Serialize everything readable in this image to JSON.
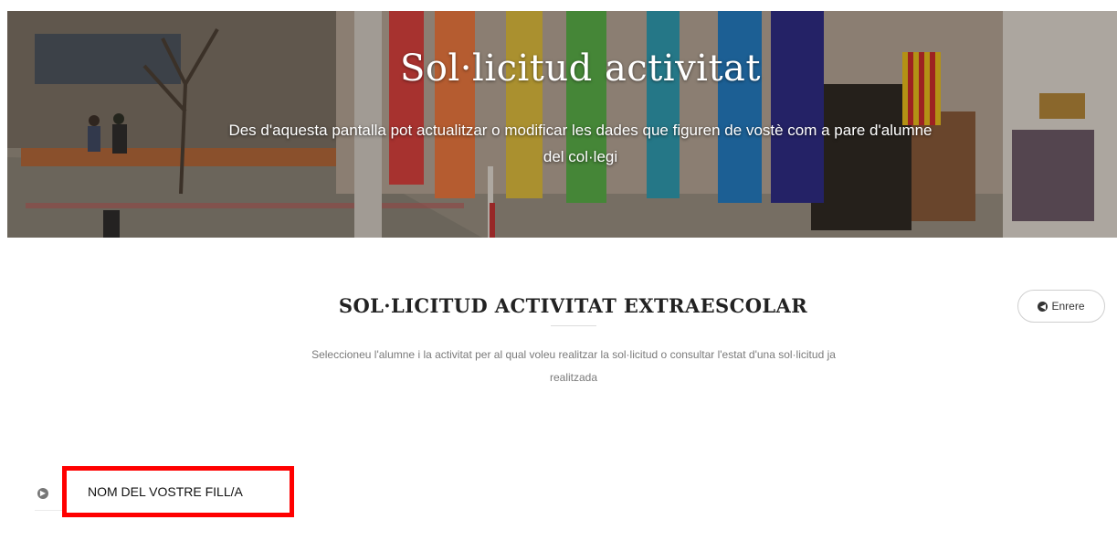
{
  "hero": {
    "title": "Sol·licitud activitat",
    "subtitle": "Des d'aquesta pantalla pot actualitzar o modificar les dades que figuren de vostè com a pare d'alumne del col·legi"
  },
  "section": {
    "title": "SOL·LICITUD ACTIVITAT EXTRAESCOLAR",
    "description": "Seleccioneu l'alumne i la activitat per al qual voleu realitzar la sol·licitud o consultar l'estat d'una sol·licitud ja realitzada"
  },
  "back_button": {
    "icon": "circle-arrow-left-icon",
    "label": "Enrere"
  },
  "children": [
    {
      "icon": "circle-arrow-right-icon",
      "label": "NOM DEL VOSTRE FILL/A",
      "highlight_color": "#ff0000"
    }
  ]
}
